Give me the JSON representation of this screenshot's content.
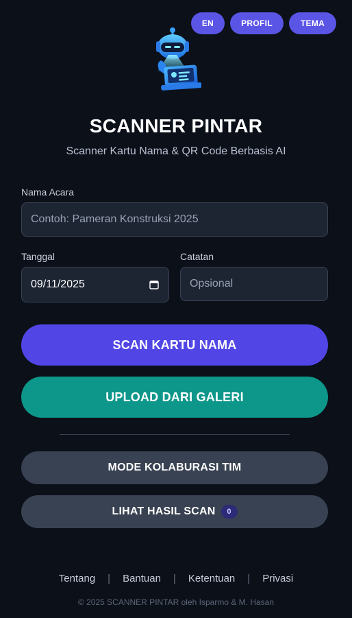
{
  "header": {
    "lang_label": "EN",
    "profile_label": "PROFIL",
    "theme_label": "TEMA"
  },
  "app": {
    "title": "SCANNER PINTAR",
    "subtitle": "Scanner Kartu Nama & QR Code Berbasis AI"
  },
  "form": {
    "event_name": {
      "label": "Nama Acara",
      "placeholder": "Contoh: Pameran Konstruksi 2025",
      "value": ""
    },
    "date": {
      "label": "Tanggal",
      "value": "09/11/2025"
    },
    "notes": {
      "label": "Catatan",
      "placeholder": "Opsional",
      "value": ""
    }
  },
  "actions": {
    "scan_label": "SCAN KARTU NAMA",
    "upload_label": "UPLOAD DARI GALERI",
    "collab_label": "MODE KOLABURASI TIM",
    "results_label": "LIHAT HASIL SCAN",
    "results_count": "0"
  },
  "footer": {
    "links": [
      "Tentang",
      "Bantuan",
      "Ketentuan",
      "Privasi"
    ],
    "copyright": "© 2025 SCANNER PINTAR oleh Isparmo & M. Hasan"
  },
  "colors": {
    "background": "#0b1019",
    "primary": "#5146e5",
    "teal": "#0d968a",
    "secondary_button": "#394252",
    "pill": "#5b55e6"
  },
  "icons": {
    "logo": "robot-scanner-icon",
    "date_picker": "calendar-icon"
  }
}
